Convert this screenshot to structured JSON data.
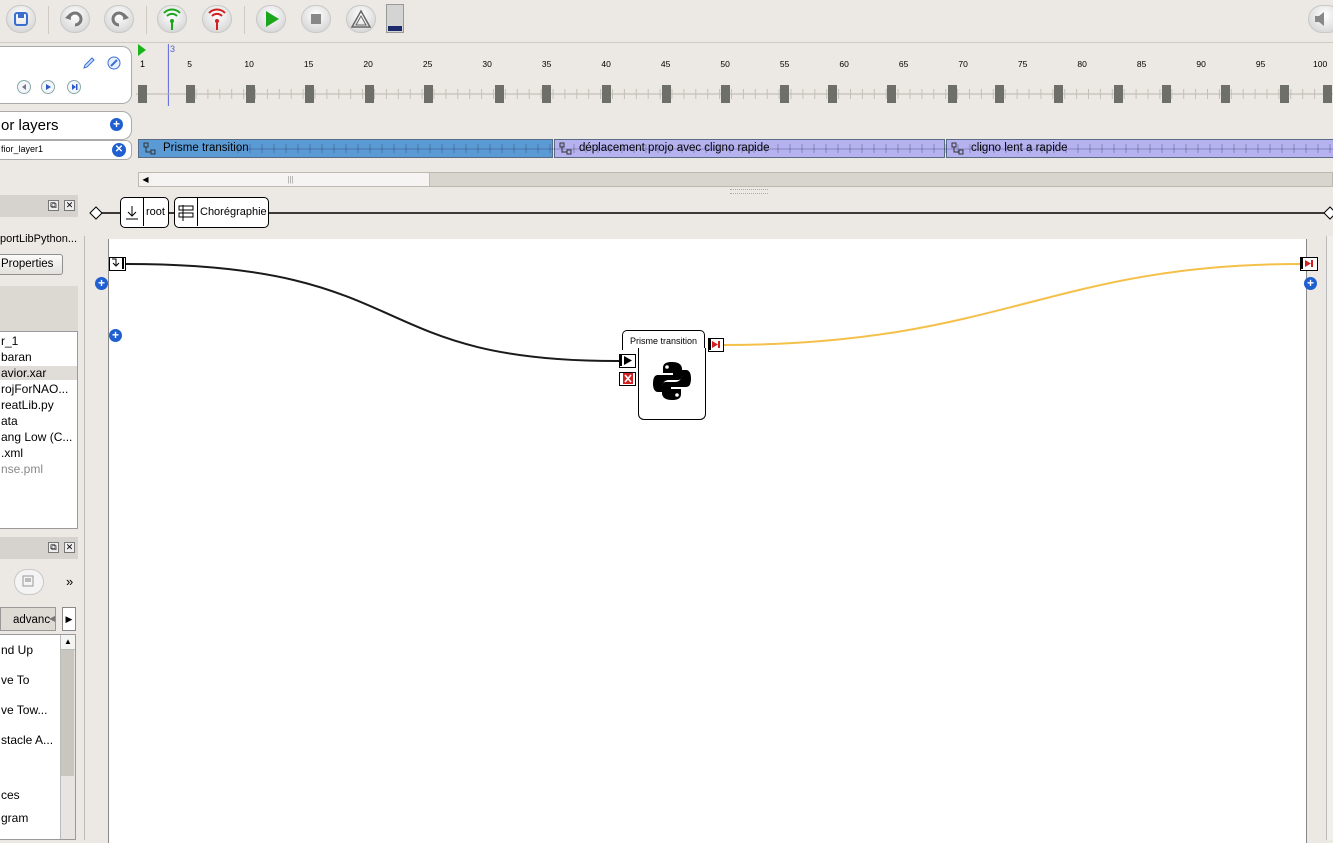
{
  "toolbar": {
    "buttons": [
      "save-icon",
      "undo-icon",
      "redo-icon",
      "connect-icon",
      "disconnect-icon",
      "play-icon",
      "stop-icon",
      "debug-icon"
    ],
    "volume_icon": "speaker-icon"
  },
  "timeline": {
    "start_frame": "1",
    "current_frame": "3",
    "ticks": [
      "5",
      "10",
      "15",
      "20",
      "25",
      "30",
      "35",
      "40",
      "45",
      "50",
      "55",
      "60",
      "65",
      "70",
      "75",
      "80",
      "85",
      "90",
      "95",
      "100"
    ]
  },
  "layers_panel": {
    "title": "or layers",
    "layer_name": "fior_layer1"
  },
  "layer_segments": [
    {
      "label": "Prisme transition",
      "color": "#5b9bd5"
    },
    {
      "label": "déplacement projo avec cligno rapide",
      "color": "#b6b2f0"
    },
    {
      "label": "cligno lent a rapide",
      "color": "#b6b2f0"
    }
  ],
  "breadcrumb": {
    "root": "root",
    "current": "Chorégraphie"
  },
  "project_panel": {
    "lib_text": "portLibPython...",
    "properties_button": "Properties",
    "files": [
      "r_1",
      "baran",
      "avior.xar",
      "rojForNAO...",
      "reatLib.py",
      "ata",
      "ang Low (C...",
      ".xml",
      "nse.pml"
    ]
  },
  "box_library": {
    "tab_label": "advanc",
    "items": [
      "nd Up",
      "ve To",
      "ve Tow...",
      "stacle A...",
      "",
      "ces",
      "gram"
    ]
  },
  "flow": {
    "box_title": "Prisme transition",
    "box_icon": "python-icon",
    "wire_color_main": "#1a1a1a",
    "wire_color_output": "#f5c04a"
  }
}
